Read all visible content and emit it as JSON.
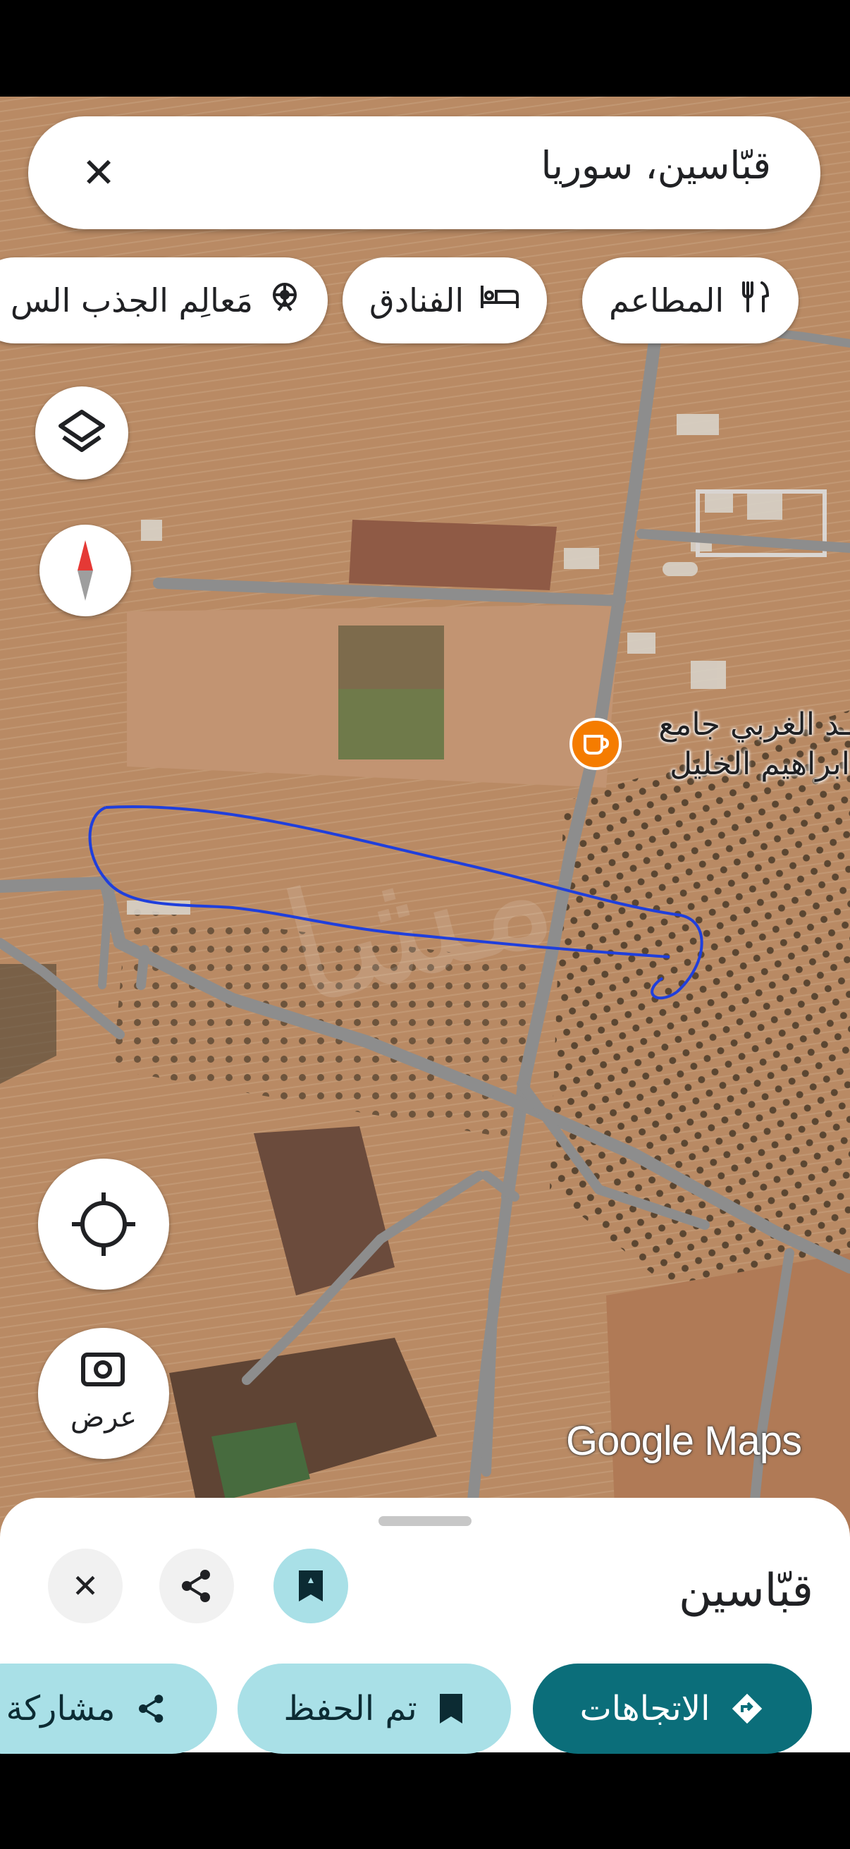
{
  "search": {
    "query": "قبّاسين، سوريا",
    "close_icon": "close-icon"
  },
  "chips": [
    {
      "label": "المطاعم",
      "icon": "restaurant-icon"
    },
    {
      "label": "الفنادق",
      "icon": "hotel-icon"
    },
    {
      "label": "مَعالِم الجذب الس",
      "icon": "attraction-icon"
    }
  ],
  "map": {
    "place_label_line1": "ـد الغربي جامع",
    "place_label_line2": "ابراهيم الخليل",
    "attribution": "Google Maps",
    "view_button_label": "عرض",
    "colors": {
      "drawn_outline": "#1f3fdc",
      "poi": "#f57c00",
      "roads": "#8e8e8e"
    }
  },
  "sheet": {
    "place_name": "قبّاسين",
    "actions": {
      "directions": "الاتجاهات",
      "saved": "تم الحفظ",
      "share": "مشاركة"
    },
    "colors": {
      "primary": "#0b6e7a",
      "tonal": "#a9e0e7"
    }
  }
}
